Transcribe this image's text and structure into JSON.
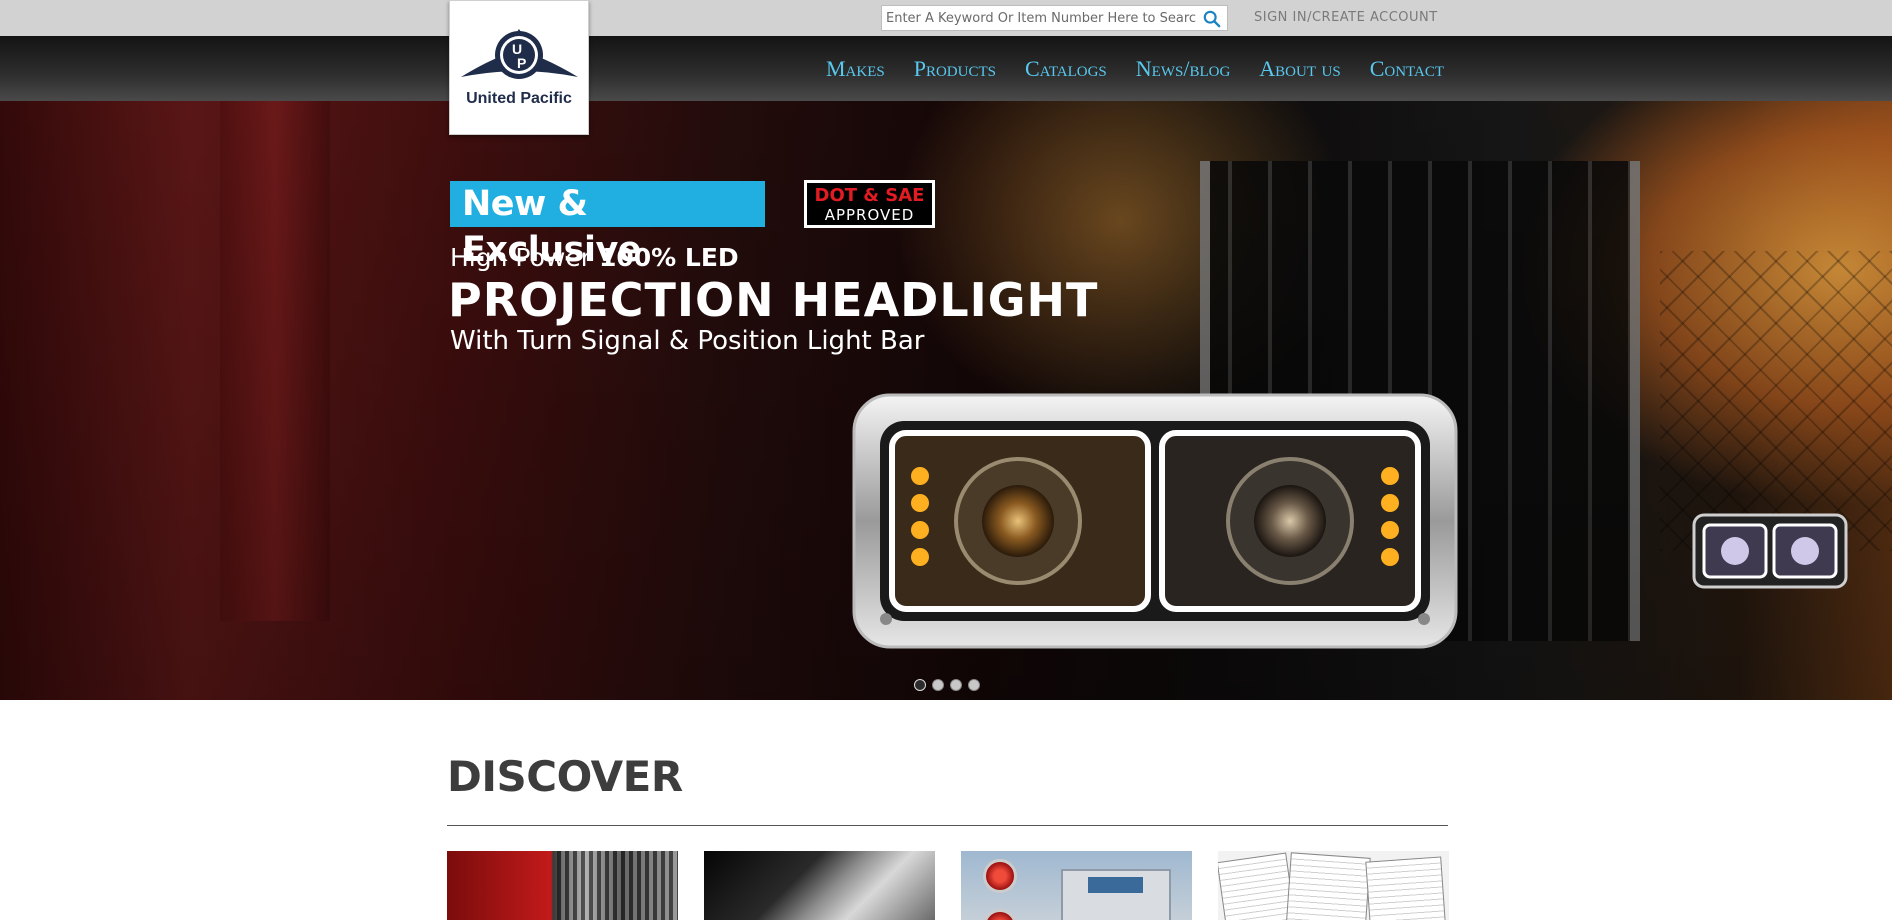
{
  "header": {
    "search": {
      "placeholder": "Enter A Keyword Or Item Number Here to Search"
    },
    "account_link": "SIGN IN/CREATE ACCOUNT",
    "logo_text": "United Pacific",
    "nav": [
      {
        "label": "Makes"
      },
      {
        "label": "Products"
      },
      {
        "label": "Catalogs"
      },
      {
        "label": "News/blog"
      },
      {
        "label": "About us"
      },
      {
        "label": "Contact"
      }
    ]
  },
  "hero": {
    "badge_new": "New & Exclusive",
    "badge_dot_line1": "DOT & SAE",
    "badge_dot_line2": "APPROVED",
    "line1_prefix": "High Power ",
    "line1_bold": "100% LED",
    "line2": "PROJECTION HEADLIGHT",
    "line3": "With Turn Signal & Position Light Bar",
    "slider": {
      "count": 4,
      "active_index": 0
    }
  },
  "discover": {
    "title": "DISCOVER"
  },
  "colors": {
    "nav_link": "#58c8ee",
    "badge_blue": "#20afe0",
    "badge_red": "#e31b23",
    "logo_navy": "#1f2d4a"
  },
  "icons": {
    "search": "search-icon"
  }
}
